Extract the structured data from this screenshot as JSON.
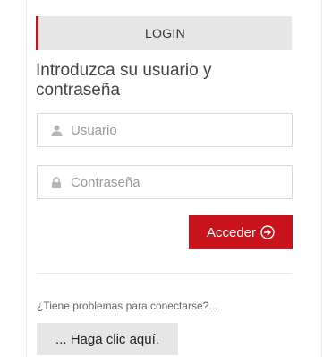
{
  "login": {
    "header": "LOGIN",
    "subtitle": "Introduzca su usuario y contraseña",
    "username": {
      "placeholder": "Usuario",
      "value": "",
      "icon": "user-icon"
    },
    "password": {
      "placeholder": "Contraseña",
      "value": "",
      "icon": "lock-icon"
    },
    "submit_label": "Acceder",
    "submit_icon": "arrow-circle-right-icon",
    "accent_color": "#c8131c"
  },
  "help": {
    "text": "¿Tiene problemas para conectarse?...",
    "button_label": "... Haga clic aquí."
  }
}
